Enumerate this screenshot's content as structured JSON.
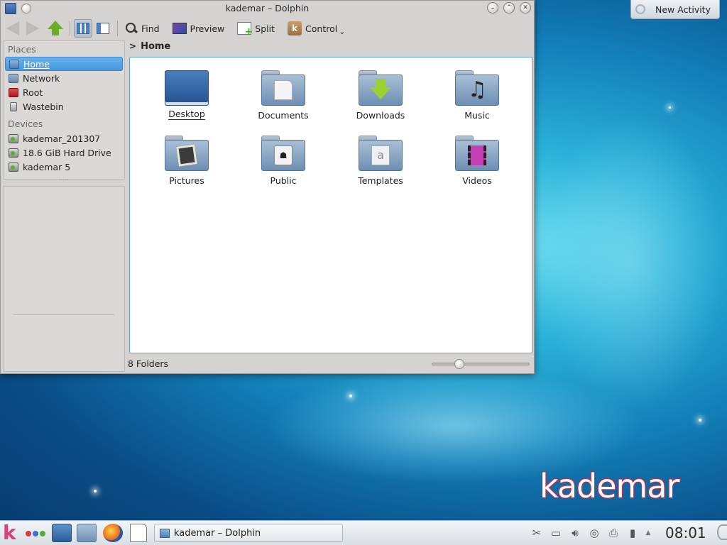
{
  "desktop": {
    "logo_text": "kademar",
    "new_activity_label": "New Activity"
  },
  "window": {
    "title": "kademar – Dolphin",
    "buttons": {
      "minimize": "⌄",
      "maximize": "⌃",
      "close": "✕"
    }
  },
  "toolbar": {
    "find_label": "Find",
    "preview_label": "Preview",
    "split_label": "Split",
    "control_label": "Control",
    "active_view_mode": "icons"
  },
  "sidebar": {
    "places_title": "Places",
    "places": [
      {
        "label": "Home",
        "icon": "home-icon",
        "selected": true
      },
      {
        "label": "Network",
        "icon": "network-icon"
      },
      {
        "label": "Root",
        "icon": "root-folder-icon"
      },
      {
        "label": "Wastebin",
        "icon": "wastebin-icon"
      }
    ],
    "devices_title": "Devices",
    "devices": [
      {
        "label": "kademar_201307",
        "icon": "drive-icon"
      },
      {
        "label": "18.6 GiB Hard Drive",
        "icon": "drive-icon"
      },
      {
        "label": "kademar 5",
        "icon": "drive-icon"
      }
    ]
  },
  "breadcrumb": {
    "current": "Home"
  },
  "files": [
    {
      "label": "Desktop",
      "icon": "desktop-folder-icon",
      "focused": true
    },
    {
      "label": "Documents",
      "icon": "documents-folder-icon"
    },
    {
      "label": "Downloads",
      "icon": "downloads-folder-icon"
    },
    {
      "label": "Music",
      "icon": "music-folder-icon"
    },
    {
      "label": "Pictures",
      "icon": "pictures-folder-icon"
    },
    {
      "label": "Public",
      "icon": "public-folder-icon"
    },
    {
      "label": "Templates",
      "icon": "templates-folder-icon"
    },
    {
      "label": "Videos",
      "icon": "videos-folder-icon"
    }
  ],
  "status": {
    "text": "8 Folders",
    "zoom_level_fraction": 0.25
  },
  "taskbar": {
    "kicker_label": "k",
    "task_label": "kademar – Dolphin",
    "clock": "08:01",
    "activity_dot_colors": [
      "#d33a3a",
      "#3d6fd1",
      "#4caf3a"
    ],
    "tray_icons": [
      "clipboard-scissors-icon",
      "display-icon",
      "volume-icon",
      "network-globe-icon",
      "printer-icon",
      "battery-icon"
    ]
  }
}
